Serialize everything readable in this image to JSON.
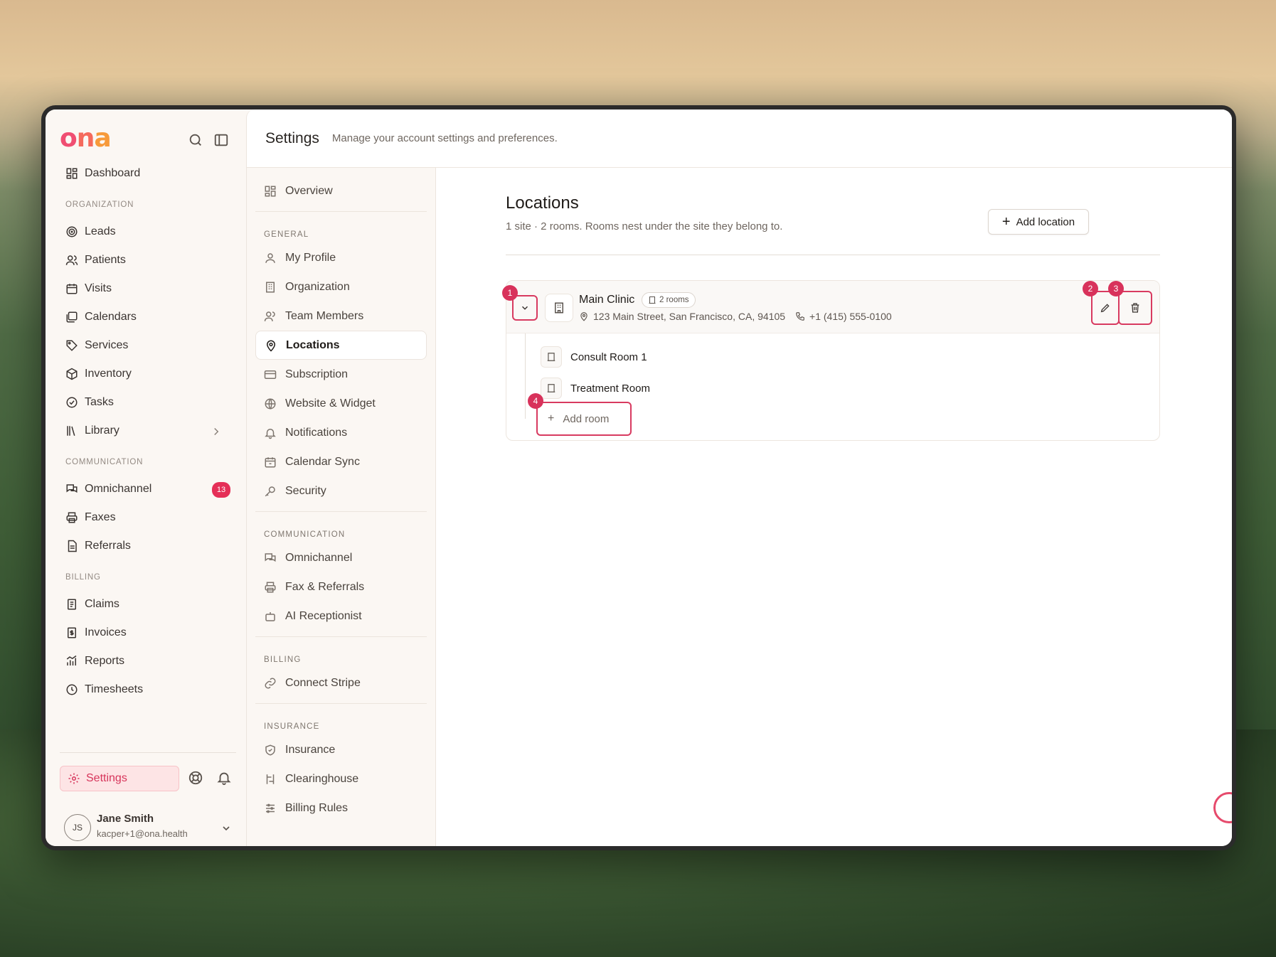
{
  "logo": {
    "text_a": "o",
    "text_b": "n",
    "text_c": "a"
  },
  "sidebar": {
    "dashboard": "Dashboard",
    "sections": {
      "organization": "ORGANIZATION",
      "communication": "COMMUNICATION",
      "billing": "BILLING"
    },
    "org_items": [
      "Leads",
      "Patients",
      "Visits",
      "Calendars",
      "Services",
      "Inventory",
      "Tasks",
      "Library"
    ],
    "comm_items": [
      "Omnichannel",
      "Faxes",
      "Referrals"
    ],
    "omnichannel_badge": "13",
    "billing_items": [
      "Claims",
      "Invoices",
      "Reports",
      "Timesheets"
    ],
    "settings_label": "Settings",
    "user": {
      "initials": "JS",
      "name": "Jane Smith",
      "email": "kacper+1@ona.health"
    }
  },
  "header": {
    "title": "Settings",
    "subtitle": "Manage your account settings and preferences."
  },
  "subnav": {
    "overview": "Overview",
    "general_section": "GENERAL",
    "general": [
      "My Profile",
      "Organization",
      "Team Members",
      "Locations",
      "Subscription",
      "Website & Widget",
      "Notifications",
      "Calendar Sync",
      "Security"
    ],
    "communication_section": "COMMUNICATION",
    "communication": [
      "Omnichannel",
      "Fax & Referrals",
      "AI Receptionist"
    ],
    "billing_section": "BILLING",
    "billing": [
      "Connect Stripe"
    ],
    "insurance_section": "INSURANCE",
    "insurance": [
      "Insurance",
      "Clearinghouse",
      "Billing Rules"
    ]
  },
  "locations": {
    "title": "Locations",
    "subtitle": "1 site · 2 rooms. Rooms nest under the site they belong to.",
    "add_location": "Add location",
    "site": {
      "name": "Main Clinic",
      "rooms_pill": "2 rooms",
      "address": "123 Main Street, San Francisco, CA, 94105",
      "phone": "+1 (415) 555-0100"
    },
    "rooms": [
      "Consult Room 1",
      "Treatment Room"
    ],
    "add_room": "Add room",
    "markers": [
      "1",
      "2",
      "3",
      "4"
    ]
  },
  "colors": {
    "accent": "#d83a60",
    "badge": "#e52f57",
    "logo_pink": "#f04e72",
    "logo_orange": "#f79a3a"
  }
}
